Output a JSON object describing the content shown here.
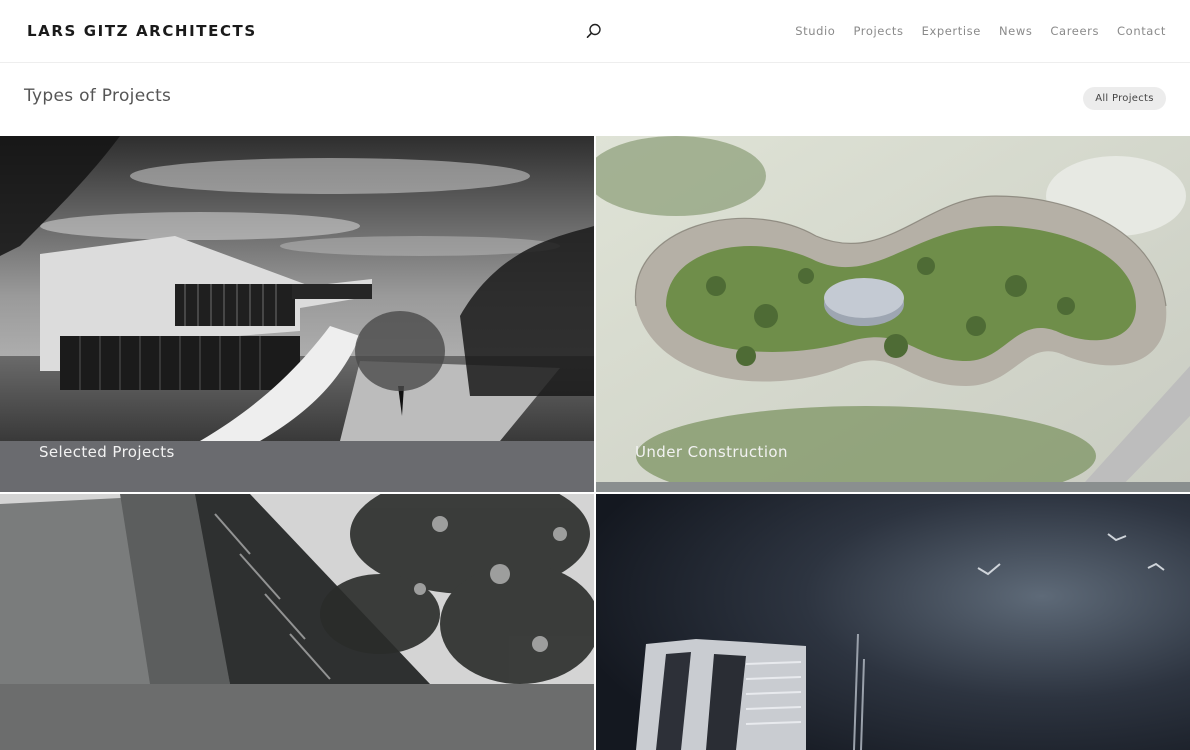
{
  "header": {
    "logo": "LARS GITZ ARCHITECTS",
    "nav": [
      "Studio",
      "Projects",
      "Expertise",
      "News",
      "Careers",
      "Contact"
    ],
    "search_icon": "search-icon"
  },
  "subheader": {
    "title": "Types of Projects",
    "all_projects_label": "All Projects"
  },
  "tiles": [
    {
      "label": "Selected Projects"
    },
    {
      "label": "Under Construction"
    },
    {
      "label": ""
    },
    {
      "label": ""
    }
  ]
}
